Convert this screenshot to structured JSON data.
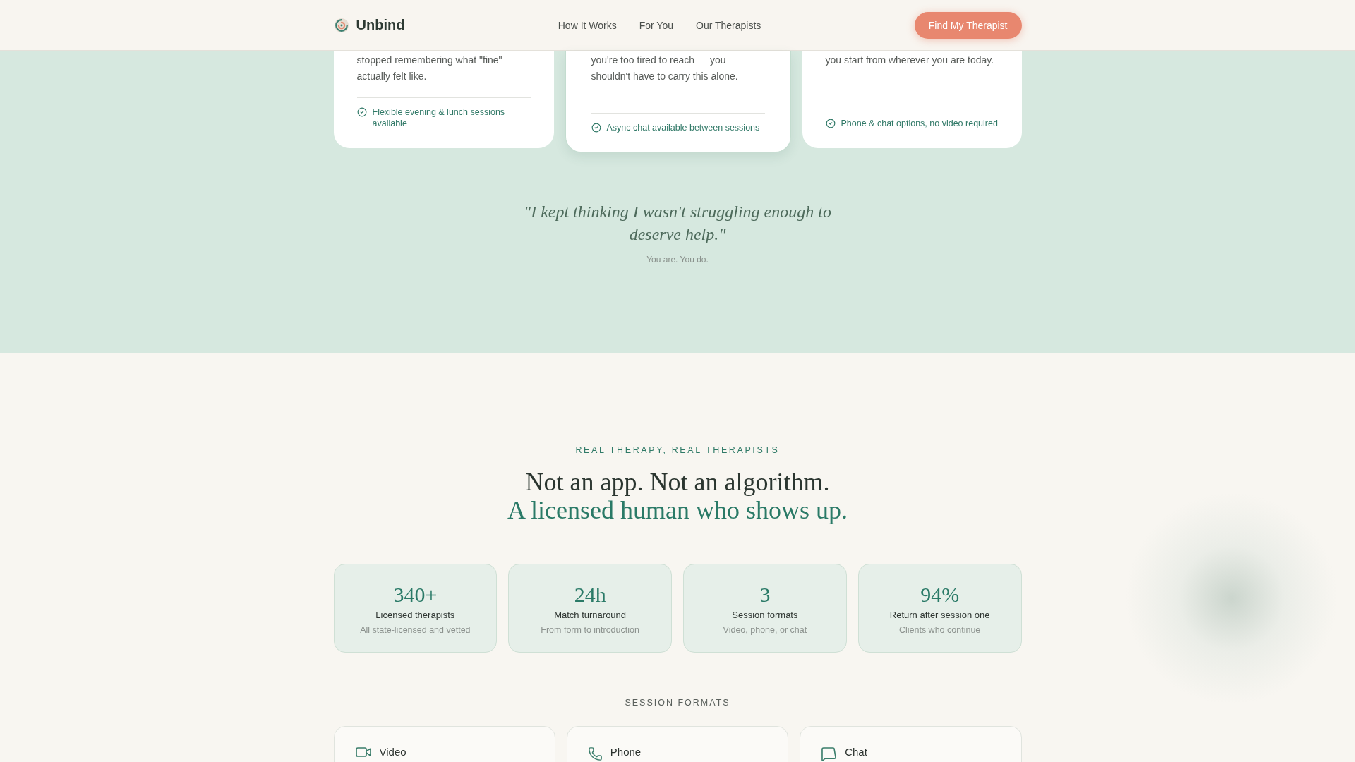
{
  "header": {
    "brand": "Unbind",
    "nav": [
      "How It Works",
      "For You",
      "Our Therapists"
    ],
    "cta": "Find My Therapist"
  },
  "cards": [
    {
      "text": "stopped remembering what \"fine\" actually felt like.",
      "feature": "Flexible evening & lunch sessions available",
      "highlighted": false
    },
    {
      "text": "you're too tired to reach — you shouldn't have to carry this alone.",
      "feature": "Async chat available between sessions",
      "highlighted": true
    },
    {
      "text": "you start from wherever you are today.",
      "feature": "Phone & chat options, no video required",
      "highlighted": false
    }
  ],
  "quote": {
    "text": "\"I kept thinking I wasn't struggling enough to deserve help.\"",
    "caption": "You are. You do."
  },
  "intro": {
    "eyebrow": "REAL THERAPY, REAL THERAPISTS",
    "headline": "Not an app. Not an algorithm.",
    "headline_accent": "A licensed human who shows up."
  },
  "stats": [
    {
      "value": "340+",
      "label": "Licensed therapists",
      "note": "All state-licensed and vetted"
    },
    {
      "value": "24h",
      "label": "Match turnaround",
      "note": "From form to introduction"
    },
    {
      "value": "3",
      "label": "Session formats",
      "note": "Video, phone, or chat"
    },
    {
      "value": "94%",
      "label": "Return after session one",
      "note": "Clients who continue"
    }
  ],
  "formats": {
    "title": "SESSION FORMATS",
    "items": [
      {
        "kind": "video",
        "title": "Video"
      },
      {
        "kind": "phone",
        "title": "Phone"
      },
      {
        "kind": "chat",
        "title": "Chat"
      }
    ]
  }
}
